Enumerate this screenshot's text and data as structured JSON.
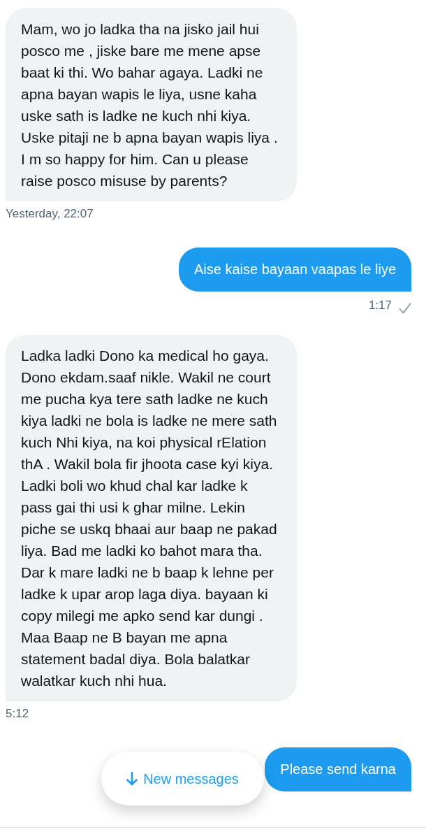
{
  "messages": [
    {
      "kind": "received",
      "text": "Mam, wo jo ladka tha na jisko jail hui posco me , jiske bare me mene apse baat ki thi. Wo bahar agaya. Ladki ne apna bayan wapis le liya, usne kaha uske sath is ladke ne kuch nhi kiya. Uske pitaji ne b apna bayan wapis liya . I m so happy for him. Can u please raise posco misuse by parents?",
      "time": "Yesterday, 22:07",
      "checkmark": false
    },
    {
      "kind": "sent",
      "text": "Aise kaise bayaan vaapas le liye",
      "time": "1:17",
      "checkmark": true
    },
    {
      "kind": "received",
      "text": "Ladka ladki Dono ka medical ho gaya.  Dono ekdam.saaf nikle. Wakil ne court me pucha kya tere sath ladke ne kuch kiya ladki ne bola is ladke ne mere sath kuch Nhi kiya, na koi physical rElation thA . Wakil bola fir jhoota case kyi kiya. Ladki boli wo khud chal kar ladke k pass gai thi usi k ghar milne. Lekin piche se uskq bhaai aur baap ne pakad liya. Bad me ladki ko bahot mara tha. Dar k mare ladki ne b baap k lehne per ladke k upar arop laga diya. bayaan ki copy milegi me apko send kar dungi . Maa Baap ne B bayan me apna statement badal diya.  Bola balatkar walatkar kuch nhi hua.",
      "time": "5:12",
      "checkmark": false
    },
    {
      "kind": "sent",
      "text": "Please send karna",
      "checkmark": false
    }
  ],
  "new_messages_button": {
    "label": "New messages"
  }
}
